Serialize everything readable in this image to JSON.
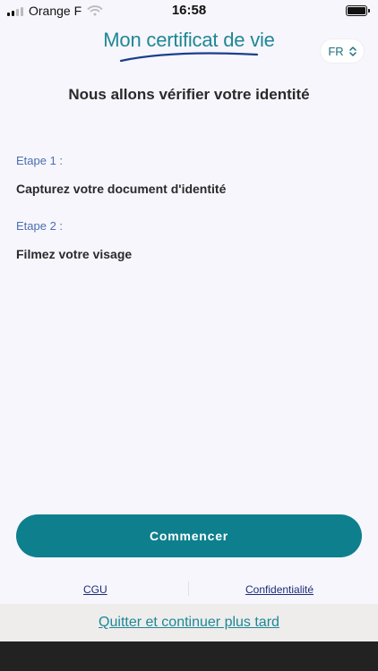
{
  "status_bar": {
    "carrier": "Orange F",
    "time": "16:58",
    "battery_level": 1.0,
    "signal_icon": "signal-icon",
    "wifi_icon": "wifi-icon",
    "battery_icon": "battery-icon"
  },
  "header": {
    "logo_text": "Mon certificat de vie",
    "language": "FR",
    "language_icon": "chevron-up-down-icon"
  },
  "main": {
    "title": "Nous allons vérifier votre identité",
    "steps": [
      {
        "label": "Etape 1 :",
        "text": "Capturez votre document d'identité"
      },
      {
        "label": "Etape 2 :",
        "text": "Filmez votre visage"
      }
    ]
  },
  "actions": {
    "start_label": "Commencer",
    "cgu_label": "CGU",
    "privacy_label": "Confidentialité",
    "quit_label": "Quitter et continuer plus tard"
  },
  "colors": {
    "accent": "#0E7F8D",
    "step_label": "#4A6FB0",
    "background": "#F7F6FC",
    "link": "#1B2D7A"
  }
}
